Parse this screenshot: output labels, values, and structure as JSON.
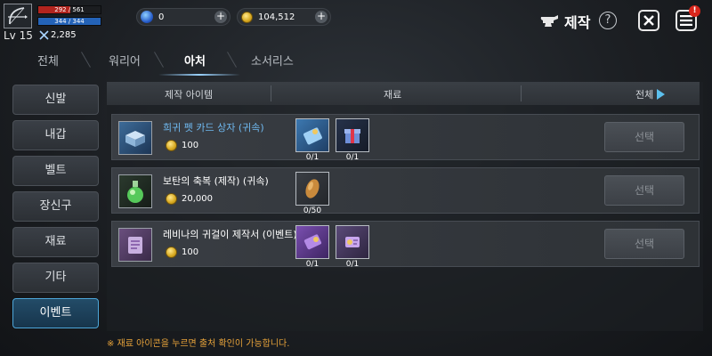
{
  "player": {
    "hp_text": "292 / 561",
    "hp_ratio": 0.52,
    "mp_text": "344 / 344",
    "mp_ratio": 1.0,
    "level": "Lv 15",
    "power": "2,285"
  },
  "currency": {
    "gems": "0",
    "gold": "104,512"
  },
  "header": {
    "title": "제작",
    "help": "?",
    "menu_badge": "!"
  },
  "tabs": [
    {
      "label": "전체"
    },
    {
      "label": "워리어"
    },
    {
      "label": "아처"
    },
    {
      "label": "소서리스"
    }
  ],
  "sidebar": [
    {
      "label": "신발"
    },
    {
      "label": "내갑"
    },
    {
      "label": "벨트"
    },
    {
      "label": "장신구"
    },
    {
      "label": "재료"
    },
    {
      "label": "기타"
    },
    {
      "label": "이벤트"
    }
  ],
  "table": {
    "headers": {
      "item": "제작 아이템",
      "materials": "재료",
      "filter": "전체"
    },
    "rows": [
      {
        "name": "희귀 펫 카드 상자 (귀속)",
        "cost": "100",
        "materials": [
          {
            "icon": "pet-card-icon",
            "count": "0/1"
          },
          {
            "icon": "gift-box-icon",
            "count": "0/1"
          }
        ],
        "button": "선택"
      },
      {
        "name": "보탄의 축복 (제작) (귀속)",
        "cost": "20,000",
        "materials": [
          {
            "icon": "seed-icon",
            "count": "0/50"
          }
        ],
        "button": "선택"
      },
      {
        "name": "레비나의 귀걸이 제작서 (이벤트)",
        "cost": "100",
        "materials": [
          {
            "icon": "earring-recipe-icon",
            "count": "0/1"
          },
          {
            "icon": "earring-piece-icon",
            "count": "0/1"
          }
        ],
        "button": "선택"
      }
    ]
  },
  "footer": {
    "note": "※ 재료 아이콘을 누르면 출처 확인이 가능합니다."
  },
  "colors": {
    "accent": "#4da6d9",
    "rare_name": "#6fb9f0",
    "note": "#e6a23a",
    "hp": "#b2241e",
    "mp": "#2463b8"
  }
}
